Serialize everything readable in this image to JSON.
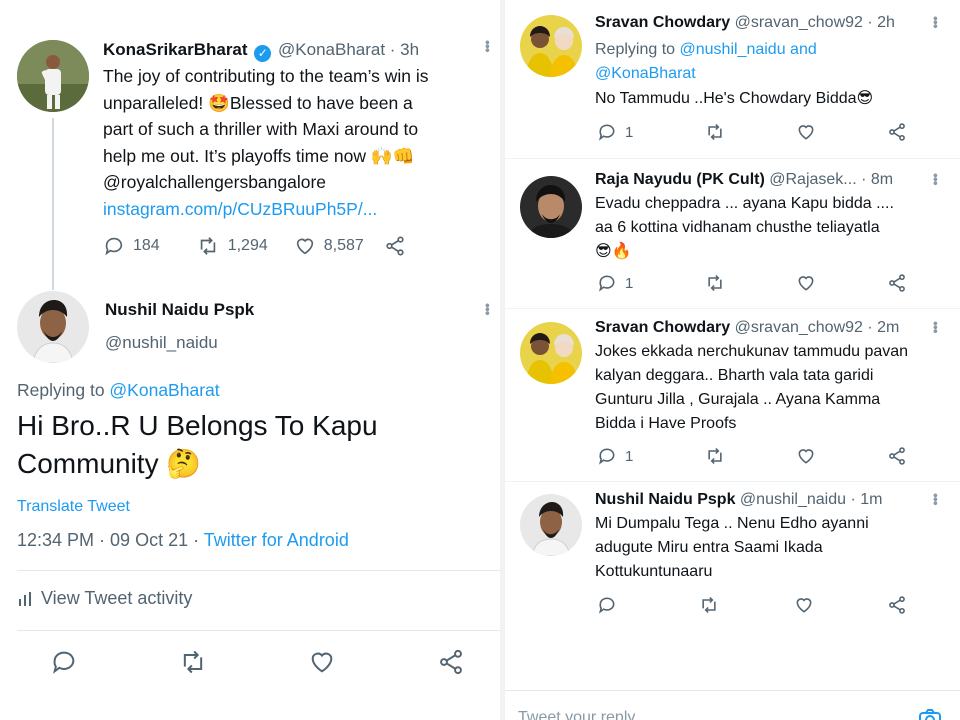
{
  "main_tweet": {
    "name": "KonaSrikarBharat",
    "handle": "@KonaBharat · 3h",
    "text_lines": [
      "The joy of contributing to the team’s win is",
      "unparalleled! 🤩Blessed to have been a",
      "part of such a thriller with Maxi around to",
      "help me out. It’s playoffs time now 🙌👊",
      "@royalchallengersbangalore"
    ],
    "link": "instagram.com/p/CUzBRuuPh5P/...",
    "replies": "184",
    "retweets": "1,294",
    "likes": "8,587"
  },
  "reply_tweet": {
    "name": "Nushil Naidu Pspk",
    "handle": "@nushil_naidu",
    "replying_prefix": "Replying to ",
    "replying_to": "@KonaBharat",
    "text_line1": "Hi Bro..R U Belongs To Kapu",
    "text_line2": "Community 🤔",
    "translate": "Translate Tweet",
    "time": "12:34 PM · 09 Oct 21 · ",
    "source": "Twitter for Android",
    "activity": "View Tweet activity"
  },
  "replies": [
    {
      "name": "Sravan Chowdary",
      "handle": "@sravan_chow92 · 2h",
      "replying_prefix": "Replying to ",
      "replying_line1": "@nushil_naidu and",
      "replying_line2": "@KonaBharat",
      "lines": [
        "No Tammudu ..He's Chowdary Bidda😎"
      ],
      "reply_count": "1"
    },
    {
      "name": "Raja Nayudu (PK Cult)",
      "handle": "@Rajasek... · 8m",
      "lines": [
        "Evadu cheppadra ... ayana Kapu bidda ....",
        "aa 6 kottina vidhanam chusthe teliayatla",
        "😎🔥"
      ],
      "reply_count": "1"
    },
    {
      "name": "Sravan Chowdary",
      "handle": "@sravan_chow92 · 2m",
      "lines": [
        "Jokes ekkada nerchukunav tammudu pavan",
        "kalyan deggara.. Bharth vala tata garidi",
        "Gunturu Jilla , Gurajala .. Ayana Kamma",
        "Bidda i Have Proofs"
      ],
      "reply_count": "1"
    },
    {
      "name": "Nushil Naidu Pspk",
      "handle": "@nushil_naidu · 1m",
      "lines": [
        "Mi Dumpalu Tega .. Nenu Edho ayanni",
        "adugute Miru entra Saami Ikada",
        "Kottukuntunaaru"
      ],
      "reply_count": ""
    }
  ],
  "compose_placeholder": "Tweet your reply",
  "colors": {
    "link": "#1d9bf0",
    "muted": "#536471",
    "divider": "#eff3f4"
  }
}
